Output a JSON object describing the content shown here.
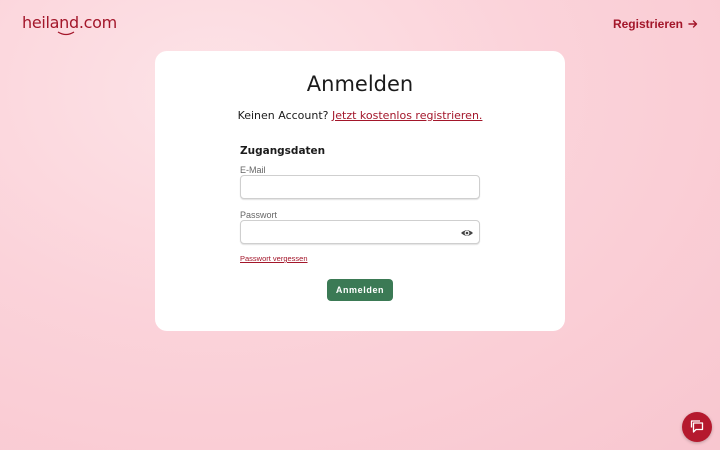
{
  "header": {
    "logo_text": "heiland.com",
    "register_label": "Registrieren",
    "register_icon": "arrow-right-icon"
  },
  "login": {
    "title": "Anmelden",
    "no_account_text": "Keinen Account?",
    "register_link": "Jetzt kostenlos registrieren.",
    "section_title": "Zugangsdaten",
    "email_label": "E-Mail",
    "email_value": "",
    "password_label": "Passwort",
    "password_value": "",
    "password_toggle_icon": "eye-icon",
    "forgot_password": "Passwort vergessen",
    "submit_label": "Anmelden"
  },
  "chat": {
    "icon": "chat-bubble-icon"
  },
  "colors": {
    "brand_red": "#a3162a",
    "submit_green": "#3b7a55",
    "chat_red": "#b5192e",
    "background_pink": "#fbd3da"
  }
}
